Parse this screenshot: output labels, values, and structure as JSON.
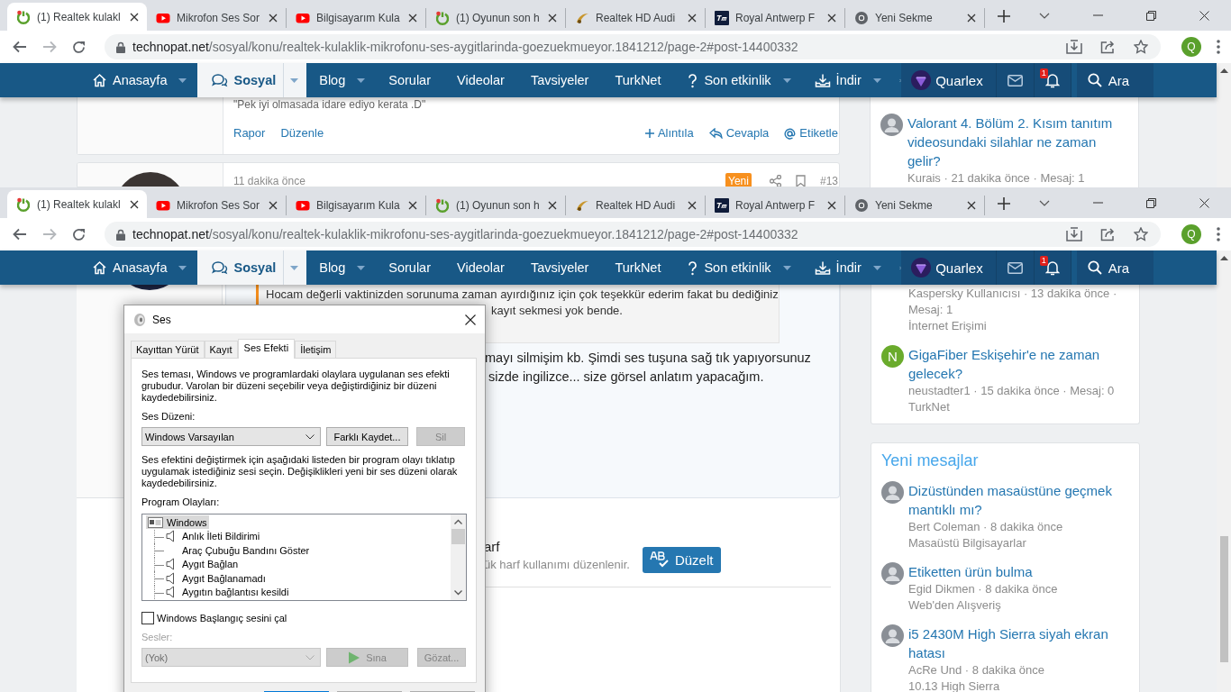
{
  "windows": [
    {
      "tabs": [
        {
          "title": "(1) Realtek kulakl",
          "kind": "technopat",
          "selected": true
        },
        {
          "title": "Mikrofon Ses Sor",
          "kind": "youtube",
          "selected": false
        },
        {
          "title": "Bilgisayarım Kula",
          "kind": "youtube",
          "selected": false
        },
        {
          "title": "(1) Oyunun son h",
          "kind": "technopat",
          "selected": false
        },
        {
          "title": "Realtek HD Audi",
          "kind": "realtek",
          "selected": false
        },
        {
          "title": "Royal Antwerp F",
          "kind": "tm",
          "selected": false
        },
        {
          "title": "Yeni Sekme",
          "kind": "chrome",
          "selected": false
        }
      ],
      "url": {
        "domain": "technopat.net",
        "path": "/sosyal/konu/realtek-kulaklik-mikrofonu-ses-aygitlarinda-goezuekmueyor.1841212/page-2#post-14400332"
      },
      "profile": "Q",
      "nav": {
        "items": [
          {
            "label": "Anasayfa",
            "kind": "home",
            "menu": true,
            "selected": false
          },
          {
            "label": "Sosyal",
            "kind": "chat",
            "menu": true,
            "selected": true
          },
          {
            "label": "Blog",
            "menu": true,
            "selected": false
          },
          {
            "label": "Sorular",
            "menu": false,
            "selected": false
          },
          {
            "label": "Videolar",
            "menu": false,
            "selected": false
          },
          {
            "label": "Tavsiyeler",
            "menu": false,
            "selected": false
          },
          {
            "label": "TurkNet",
            "menu": false,
            "selected": false
          },
          {
            "label": "Son etkinlik",
            "kind": "bulb",
            "menu": true,
            "selected": false
          },
          {
            "label": "İndir",
            "kind": "download",
            "menu": true,
            "selected": false
          }
        ],
        "user": "Quarlex",
        "alerts": "1",
        "search": "Ara"
      },
      "page": {
        "kind": "post_view",
        "post": {
          "quote": "\"Pek iyi olmasada idare ediyo kerata .D\"",
          "left_links": [
            "Rapor",
            "Düzenle"
          ],
          "right_links": [
            {
              "label": "Alıntıla",
              "kind": "plus"
            },
            {
              "label": "Cevapla",
              "kind": "reply"
            },
            {
              "label": "Etiketle",
              "kind": "at"
            }
          ]
        },
        "next_post": {
          "time": "11 dakika önce",
          "badge": "Yeni",
          "number": "#13"
        },
        "sidebar": [
          {
            "items": [
              {
                "kind": "photo",
                "title": "Valorant 4. Bölüm 2. Kısım tanıtım videosundaki silahlar ne zaman gelir?",
                "meta": "Kurais · 21 dakika önce · Mesaj: 1"
              }
            ]
          }
        ]
      }
    },
    {
      "tabs": [
        {
          "title": "(1) Realtek kulakl",
          "kind": "technopat",
          "selected": true
        },
        {
          "title": "Mikrofon Ses Sor",
          "kind": "youtube",
          "selected": false
        },
        {
          "title": "Bilgisayarım Kula",
          "kind": "youtube",
          "selected": false
        },
        {
          "title": "(1) Oyunun son h",
          "kind": "technopat",
          "selected": false
        },
        {
          "title": "Realtek HD Audi",
          "kind": "realtek",
          "selected": false
        },
        {
          "title": "Royal Antwerp F",
          "kind": "tm",
          "selected": false
        },
        {
          "title": "Yeni Sekme",
          "kind": "chrome",
          "selected": false
        }
      ],
      "url": {
        "domain": "technopat.net",
        "path": "/sosyal/konu/realtek-kulaklik-mikrofonu-ses-aygitlarinda-goezuekmueyor.1841212/page-2#post-14400332"
      },
      "profile": "Q",
      "nav": {
        "items": [
          {
            "label": "Anasayfa",
            "kind": "home",
            "menu": true,
            "selected": false
          },
          {
            "label": "Sosyal",
            "kind": "chat",
            "menu": true,
            "selected": true
          },
          {
            "label": "Blog",
            "menu": true,
            "selected": false
          },
          {
            "label": "Sorular",
            "menu": false,
            "selected": false
          },
          {
            "label": "Videolar",
            "menu": false,
            "selected": false
          },
          {
            "label": "Tavsiyeler",
            "menu": false,
            "selected": false
          },
          {
            "label": "TurkNet",
            "menu": false,
            "selected": false
          },
          {
            "label": "Son etkinlik",
            "kind": "bulb",
            "menu": true,
            "selected": false
          },
          {
            "label": "İndir",
            "kind": "download",
            "menu": true,
            "selected": false
          }
        ],
        "user": "Quarlex",
        "alerts": "1",
        "search": "Ara"
      },
      "page": {
        "kind": "reply_view",
        "quote_lines": [
          "Hocam değerli vaktinizden sorunuma zaman ayırdığınız için çok teşekkür ederim fakat bu dediğiniz",
          "kayıt sekmesi yok bende."
        ],
        "editor_lines": [
          "mayı silmişim kb. Şimdi ses tuşuna sağ tık yapıyorsunuz",
          "sizde ingilizce... size görsel anlatım yapacağım."
        ],
        "hint": {
          "title": "arf",
          "text": "ük harf kullanımı düzenlenir.",
          "button": "Düzelt"
        },
        "sidebar": [
          {
            "items": [
              {
                "meta": "Kaspersky Kullanıcısı · 13 dakika önce · Mesaj: 1",
                "forum": "İnternet Erişimi"
              },
              {
                "kind": "letter",
                "letter": "N",
                "color": "#6aab2c",
                "title": "GigaFiber Eskişehir'e ne zaman gelecek?",
                "meta": "neustadter1 · 15 dakika önce · Mesaj: 0",
                "forum": "TurkNet"
              }
            ]
          },
          {
            "heading": "Yeni mesajlar",
            "items": [
              {
                "kind": "photo",
                "title": "Dizüstünden masaüstüne geçmek mantıklı mı?",
                "meta": "Bert Coleman · 8 dakika önce",
                "forum": "Masaüstü Bilgisayarlar"
              },
              {
                "kind": "photo",
                "title": "Etiketten ürün bulma",
                "meta": "Egid Dikmen · 8 dakika önce",
                "forum": "Web'den Alışveriş"
              },
              {
                "kind": "photo",
                "title": "i5 2430M High Sierra siyah ekran hatası",
                "meta": "AcRe Und · 8 dakika önce",
                "forum": "10.13 High Sierra"
              }
            ]
          }
        ],
        "dialog": {
          "title": "Ses",
          "tabs": [
            {
              "label": "Kayıttan Yürüt",
              "selected": false
            },
            {
              "label": "Kayıt",
              "selected": false
            },
            {
              "label": "Ses Efekti",
              "selected": true
            },
            {
              "label": "İletişim",
              "selected": false
            }
          ],
          "description": "Ses teması, Windows ve programlardaki olaylara uygulanan ses efekti grubudur. Varolan bir düzeni seçebilir veya değiştirdiğiniz bir düzeni kaydedebilirsiniz.",
          "scheme_label": "Ses Düzeni:",
          "scheme": "Windows Varsayılan",
          "save_as": "Farklı Kaydet...",
          "delete": {
            "label": "Sil",
            "disabled": true
          },
          "instructions": "Ses efektini değiştirmek için aşağıdaki listeden bir program olayı tıklatıp uygulamak istediğiniz sesi seçin. Değişiklikleri yeni bir ses düzeni olarak kaydedebilirsiniz.",
          "events_label": "Program Olayları:",
          "events": [
            {
              "label": "Windows",
              "selected": true,
              "children": [
                {
                  "label": "Anlık İleti Bildirimi",
                  "sound": true,
                  "selected": false
                },
                {
                  "label": "Araç Çubuğu Bandını Göster",
                  "sound": false,
                  "selected": false
                },
                {
                  "label": "Aygıt Bağlan",
                  "sound": true,
                  "selected": false
                },
                {
                  "label": "Aygıt Bağlanamadı",
                  "sound": true,
                  "selected": false
                },
                {
                  "label": "Aygıtın bağlantısı kesildi",
                  "sound": true,
                  "selected": false
                }
              ]
            }
          ],
          "startup": {
            "label": "Windows Başlangıç sesini çal",
            "checked": false
          },
          "sounds": {
            "label": "Sesler:",
            "value": "(Yok)",
            "test": "Sına",
            "browse": "Gözat...",
            "disabled": true
          }
        }
      }
    }
  ]
}
